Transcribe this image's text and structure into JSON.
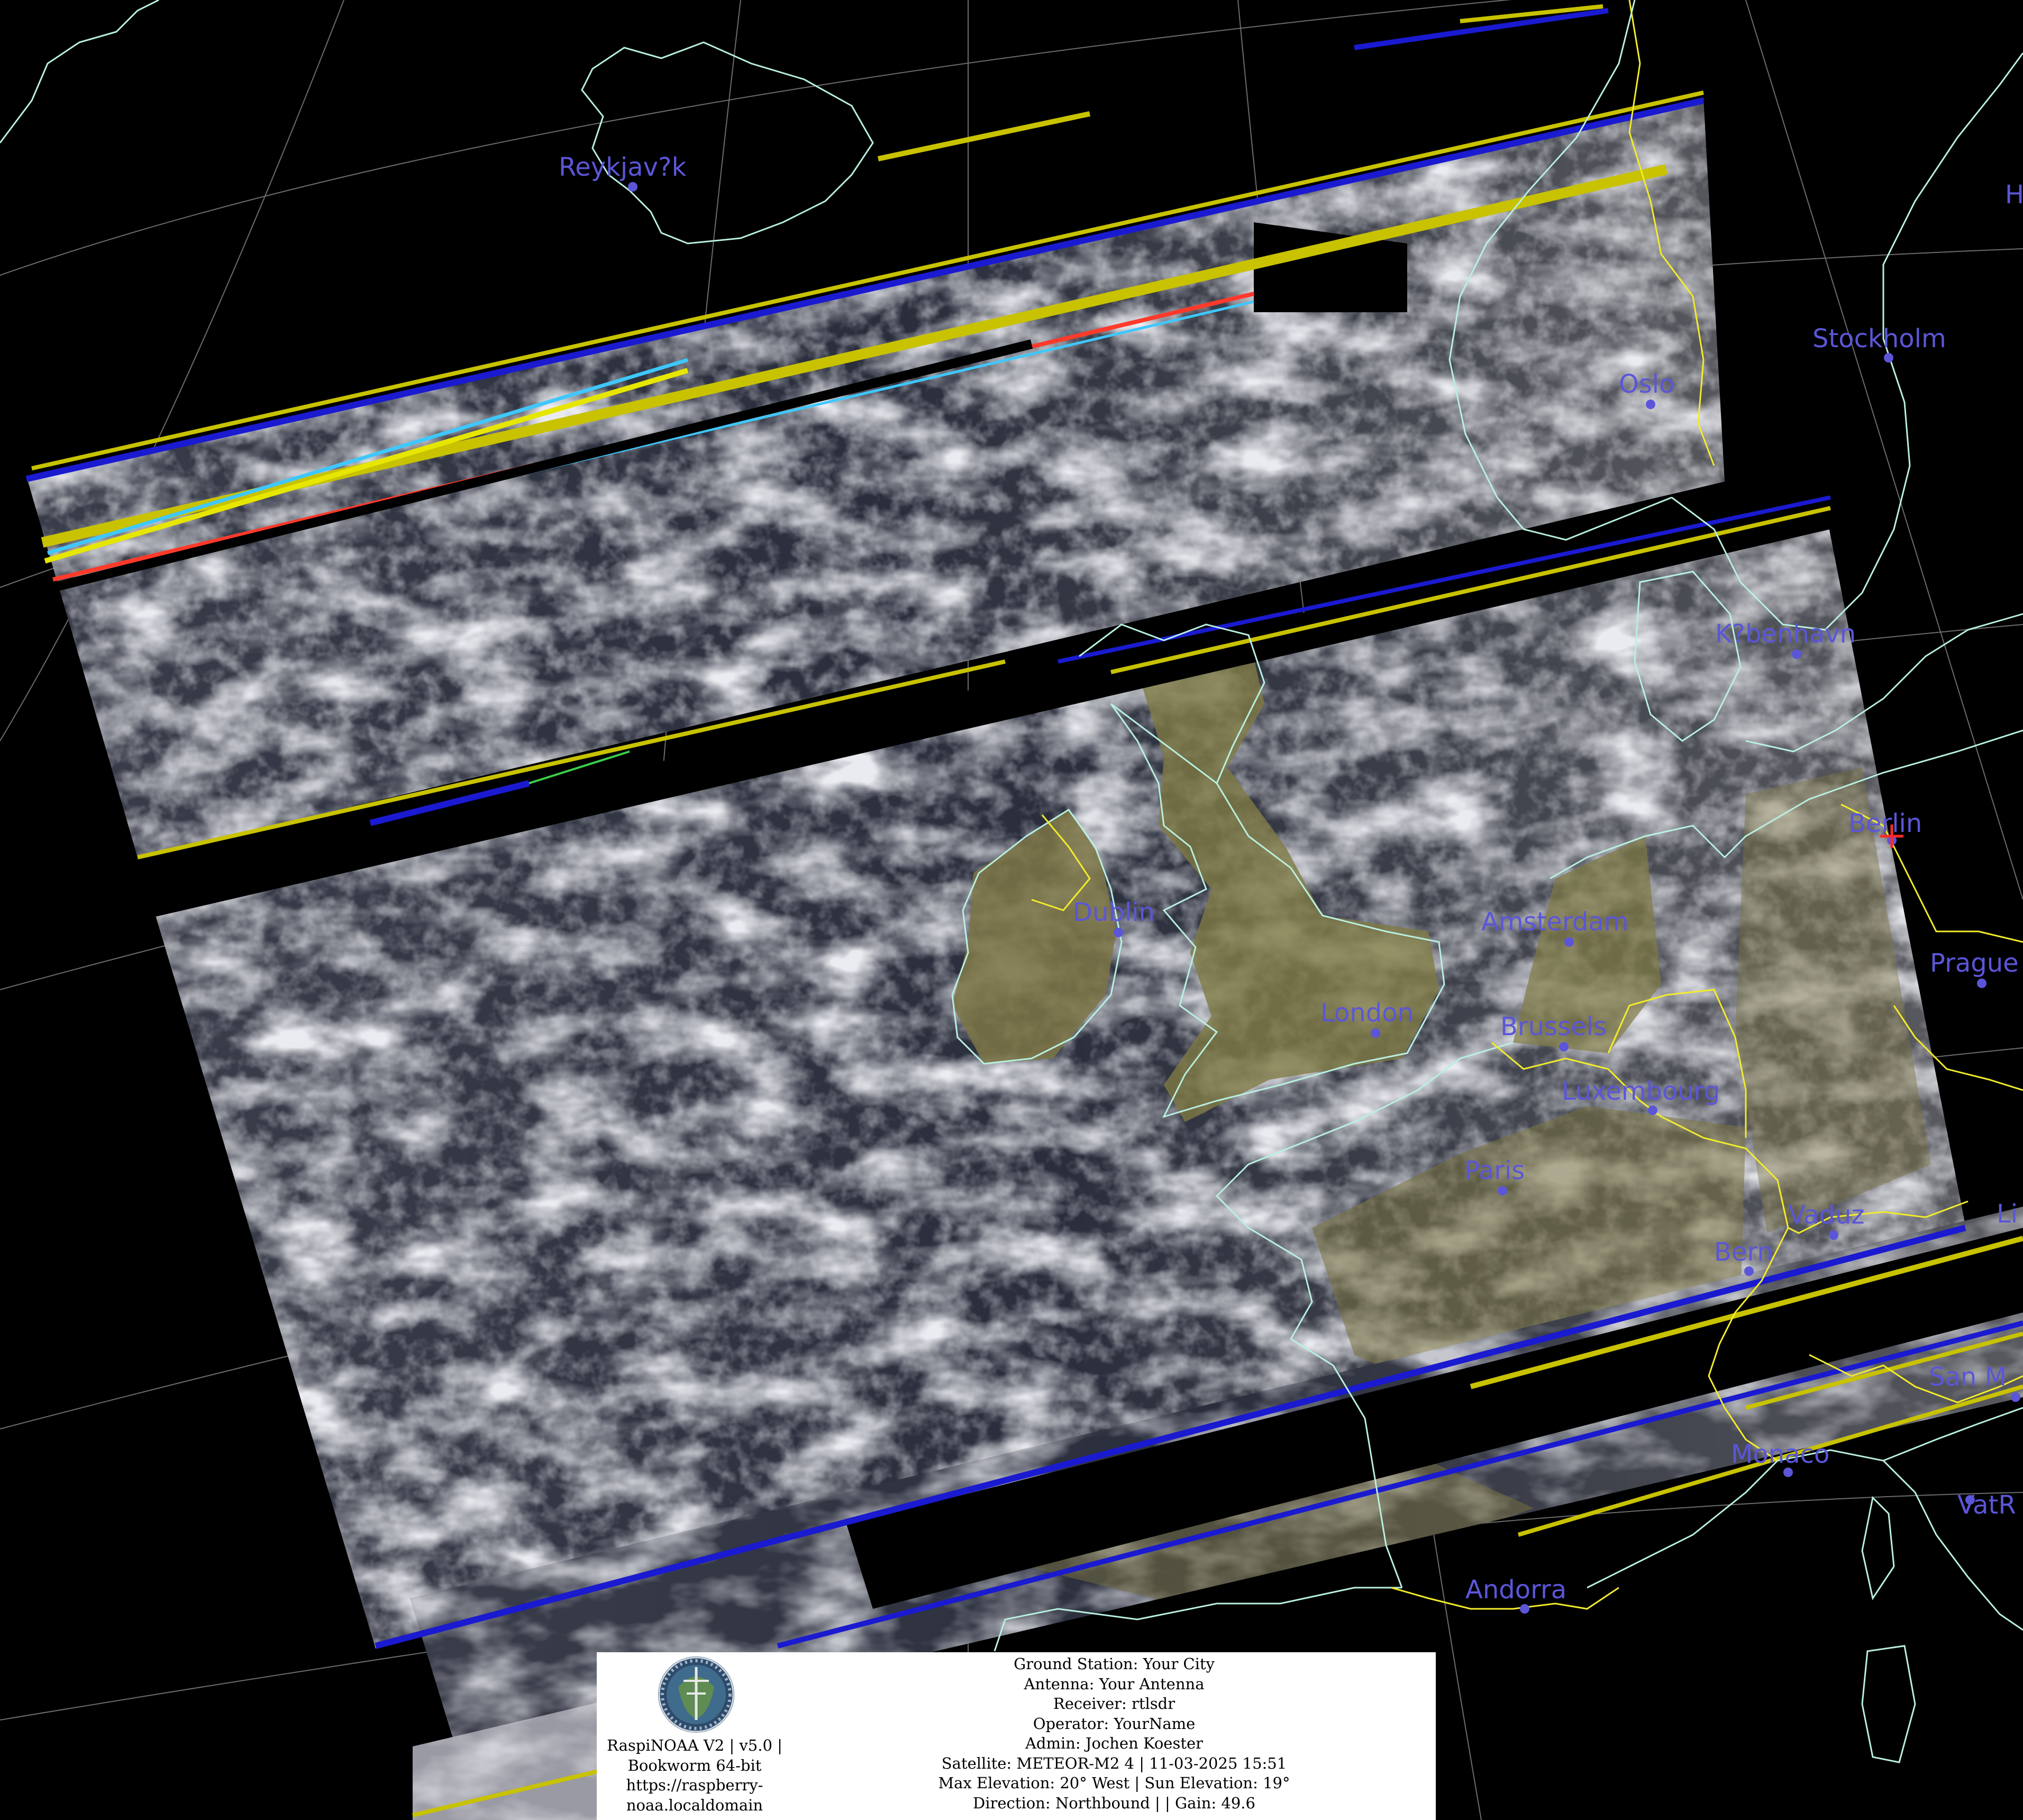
{
  "map": {
    "projection_grid": true,
    "colors": {
      "background": "#000000",
      "coastline": "#b8f0e0",
      "border": "#f2ec2a",
      "city_label": "#5b56d8",
      "city_dot": "#5b56d8",
      "grid": "#9a9a9a",
      "land_tint": "#8a8146",
      "cloud": "#cfd0d8",
      "ocean": "#2c3040",
      "gap_stripe_blue": "#1a1ad0",
      "gap_stripe_yellow": "#c8c200",
      "gap_stripe_red": "#ff3a2a",
      "gap_stripe_cyan": "#3ec8ff",
      "marker": "#ff2a2a"
    },
    "cities": [
      {
        "name": "Reykjav?k"
      },
      {
        "name": "Oslo"
      },
      {
        "name": "Stockholm"
      },
      {
        "name": "H"
      },
      {
        "name": "K?benhavn"
      },
      {
        "name": "Berlin"
      },
      {
        "name": "Prague"
      },
      {
        "name": "Dublin"
      },
      {
        "name": "Amsterdam"
      },
      {
        "name": "London"
      },
      {
        "name": "Brussels"
      },
      {
        "name": "Luxembourg"
      },
      {
        "name": "Paris"
      },
      {
        "name": "Vaduz"
      },
      {
        "name": "Bern"
      },
      {
        "name": "Li"
      },
      {
        "name": "San M"
      },
      {
        "name": "Monaco"
      },
      {
        "name": "VatR"
      },
      {
        "name": "Andorra"
      }
    ]
  },
  "info": {
    "left": {
      "logo_icon": "raspinoaa-logo-icon",
      "lines": [
        "RaspiNOAA V2 | v5.0 |",
        "Bookworm 64-bit",
        "https://raspberry-",
        "noaa.localdomain"
      ]
    },
    "right": {
      "lines": [
        "Ground Station: Your City",
        "Antenna: Your Antenna",
        "Receiver: rtlsdr",
        "Operator: YourName",
        "Admin: Jochen Koester",
        "Satellite: METEOR-M2 4 | 11-03-2025 15:51",
        "Max Elevation: 20° West | Sun Elevation: 19°",
        "Direction: Northbound | | Gain: 49.6"
      ]
    }
  }
}
